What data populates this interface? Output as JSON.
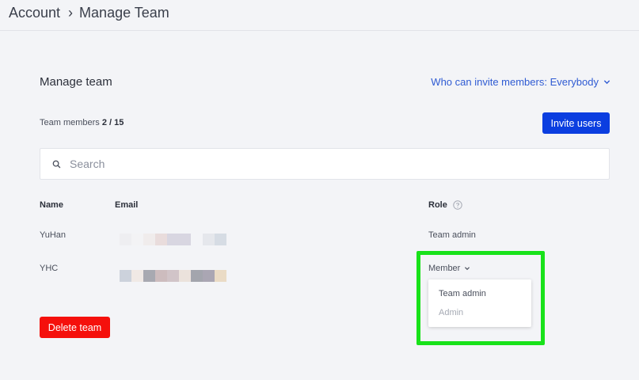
{
  "breadcrumb": {
    "parent": "Account",
    "separator": "›",
    "current": "Manage Team"
  },
  "section": {
    "title": "Manage team",
    "invite_policy_label": "Who can invite members: Everybody"
  },
  "members": {
    "label": "Team members",
    "count": "2 / 15",
    "invite_button": "Invite users"
  },
  "search": {
    "placeholder": "Search",
    "value": ""
  },
  "table": {
    "headers": {
      "name": "Name",
      "email": "Email",
      "role": "Role"
    },
    "rows": [
      {
        "name": "YuHan",
        "email_redacted": true,
        "role": "Team admin"
      },
      {
        "name": "YHC",
        "email_redacted": true,
        "role": "Member"
      }
    ]
  },
  "role_dropdown": {
    "options": [
      "Team admin",
      "Admin"
    ],
    "disabled_option": "Admin"
  },
  "delete_button": "Delete team",
  "colors": {
    "primary_button": "#0b3ee0",
    "danger_button": "#f5100c",
    "link": "#2f5bd3",
    "highlight": "#18e21a"
  },
  "icons": [
    "chevron-right-icon",
    "chevron-down-icon",
    "search-icon",
    "help-circle-icon"
  ]
}
